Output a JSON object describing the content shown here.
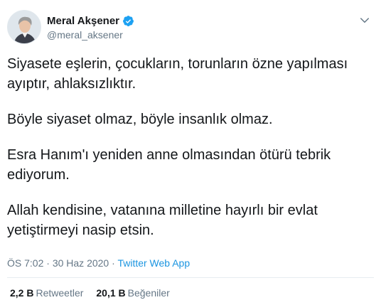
{
  "author": {
    "display_name": "Meral Akşener",
    "handle": "@meral_aksener",
    "avatar_icon": "profile-photo",
    "verified_icon": "verified-badge-icon"
  },
  "tweet": {
    "paragraphs": [
      "Siyasete eşlerin, çocukların, torunların özne yapılması\nayıptır, ahlaksızlıktır.",
      "Böyle siyaset olmaz, böyle insanlık olmaz.",
      "Esra Hanım'ı yeniden anne olmasından ötürü tebrik\nediyorum.",
      "Allah kendisine, vatanına milletine hayırlı bir evlat\nyetiştirmeyi nasip etsin."
    ],
    "time": "ÖS 7:02",
    "separator": "·",
    "date": "30 Haz 2020",
    "source": "Twitter Web App"
  },
  "stats": {
    "retweets_count": "2,2 B",
    "retweets_label": "Retweetler",
    "likes_count": "20,1 B",
    "likes_label": "Beğeniler"
  },
  "colors": {
    "text": "#14171a",
    "secondary": "#657786",
    "link": "#1b95e0",
    "verified": "#1da1f2"
  }
}
